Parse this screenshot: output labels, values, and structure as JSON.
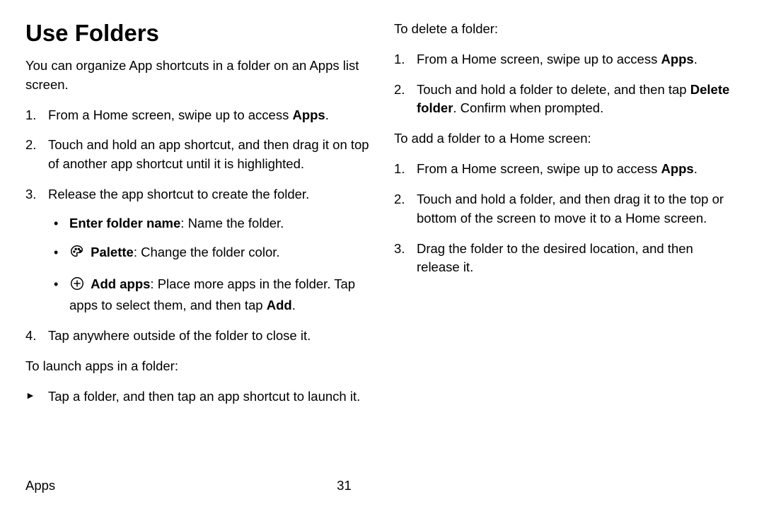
{
  "title": "Use Folders",
  "intro": "You can organize App shortcuts in a folder on an Apps list screen.",
  "left_ol": {
    "i1_before": "From a Home screen, swipe up to access ",
    "i1_bold": "Apps",
    "i1_after": ".",
    "i2": "Touch and hold an app shortcut, and then drag it on top of another app shortcut until it is highlighted.",
    "i3": "Release the app shortcut to create the folder.",
    "b1_bold": "Enter folder name",
    "b1_rest": ": Name the folder.",
    "b2_bold": "Palette",
    "b2_rest": ": Change the folder color.",
    "b3_bold": "Add apps",
    "b3_rest1": ": Place more apps in the folder. Tap apps to select them, and then tap ",
    "b3_rest_bold": "Add",
    "b3_rest2": ".",
    "i4": "Tap anywhere outside of the folder to close it."
  },
  "launch_heading": "To launch apps in a folder:",
  "launch_item": "Tap a folder, and then tap an app shortcut to launch it.",
  "delete_heading": "To delete a folder:",
  "delete_ol": {
    "i1_before": "From a Home screen, swipe up to access ",
    "i1_bold": "Apps",
    "i1_after": ".",
    "i2_before": "Touch and hold a folder to delete, and then tap ",
    "i2_bold": "Delete folder",
    "i2_after": ". Confirm when prompted."
  },
  "addhome_heading": "To add a folder to a Home screen:",
  "addhome_ol": {
    "i1_before": "From a Home screen, swipe up to access ",
    "i1_bold": "Apps",
    "i1_after": ".",
    "i2": "Touch and hold a folder, and then drag it to the top or bottom of the screen to move it to a Home screen.",
    "i3": "Drag the folder to the desired location, and then release it."
  },
  "footer_section": "Apps",
  "footer_page": "31"
}
